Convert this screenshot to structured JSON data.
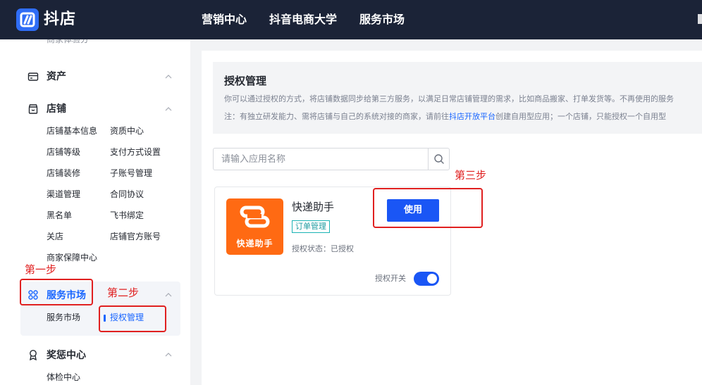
{
  "header": {
    "brand": "抖店",
    "nav": [
      "营销中心",
      "抖音电商大学",
      "服务市场"
    ]
  },
  "sidebar": {
    "cut_item": "商家体验分",
    "assets": {
      "label": "资产"
    },
    "shop": {
      "label": "店铺",
      "items": [
        "店铺基本信息",
        "资质中心",
        "店铺等级",
        "支付方式设置",
        "店铺装修",
        "子账号管理",
        "渠道管理",
        "合同协议",
        "黑名单",
        "飞书绑定",
        "关店",
        "店铺官方账号",
        "商家保障中心"
      ]
    },
    "service": {
      "label": "服务市场",
      "items": [
        "服务市场",
        "授权管理"
      ],
      "active_index": 1
    },
    "rewards": {
      "label": "奖惩中心",
      "items": [
        "体检中心"
      ]
    }
  },
  "main": {
    "notice": {
      "title": "授权管理",
      "line1": "你可以通过授权的方式，将店铺数据同步给第三方服务，以满足日常店铺管理的需求，比如商品搬家、打单发货等。不再使用的服务",
      "line2_prefix": "注：有独立研发能力、需将店铺与自己的系统对接的商家，请前往",
      "line2_link": "抖店开放平台",
      "line2_suffix": "创建自用型应用；一个店铺，只能授权一个自用型"
    },
    "search": {
      "placeholder": "请输入应用名称",
      "value": ""
    },
    "app_card": {
      "logo_text": "快递助手",
      "name": "快递助手",
      "tag": "订单管理",
      "status": "授权状态：已授权",
      "use_button": "使用",
      "switch_label": "授权开关",
      "switch_on": true
    }
  },
  "annotations": {
    "step1": "第一步",
    "step2": "第二步",
    "step3": "第三步"
  },
  "colors": {
    "topbar_bg": "#1b2337",
    "primary": "#1a56f5",
    "active_text": "#1966ff",
    "app_logo_bg": "#ff6a13",
    "tag_border": "#1bb3b5",
    "annotation_red": "#e02020",
    "page_bg": "#f2f3f5"
  }
}
